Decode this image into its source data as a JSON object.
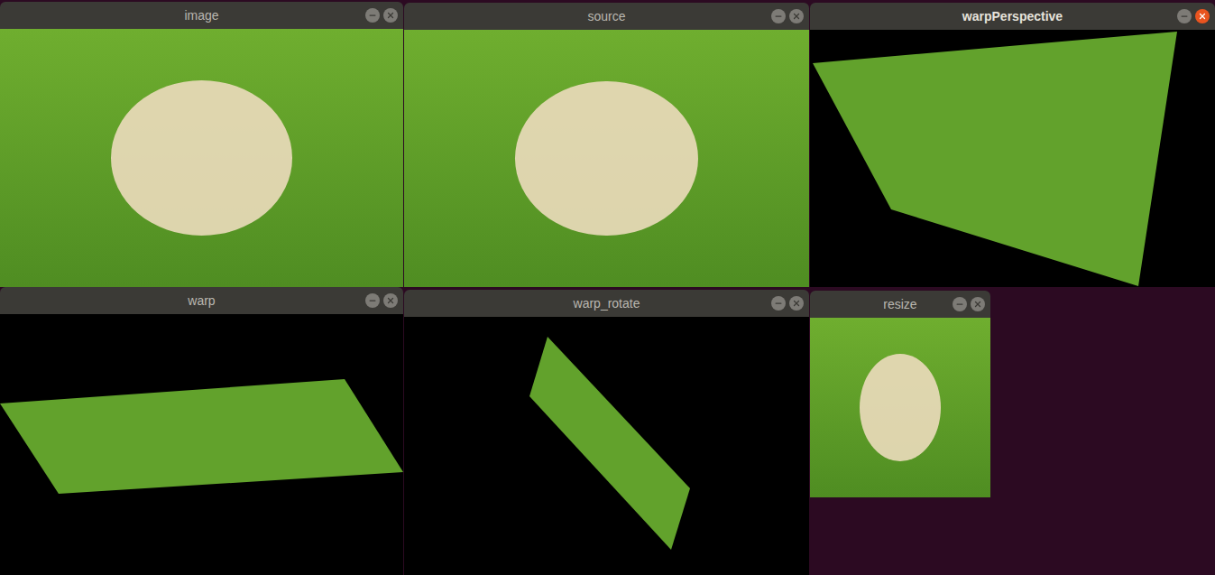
{
  "desktop": {
    "windows": [
      {
        "title": "image",
        "active": false,
        "kind": "photo"
      },
      {
        "title": "source",
        "active": false,
        "kind": "photo"
      },
      {
        "title": "warpPerspective",
        "active": true,
        "kind": "warped"
      },
      {
        "title": "warp",
        "active": false,
        "kind": "warped"
      },
      {
        "title": "warp_rotate",
        "active": false,
        "kind": "warped"
      },
      {
        "title": "resize",
        "active": false,
        "kind": "photo"
      }
    ]
  }
}
